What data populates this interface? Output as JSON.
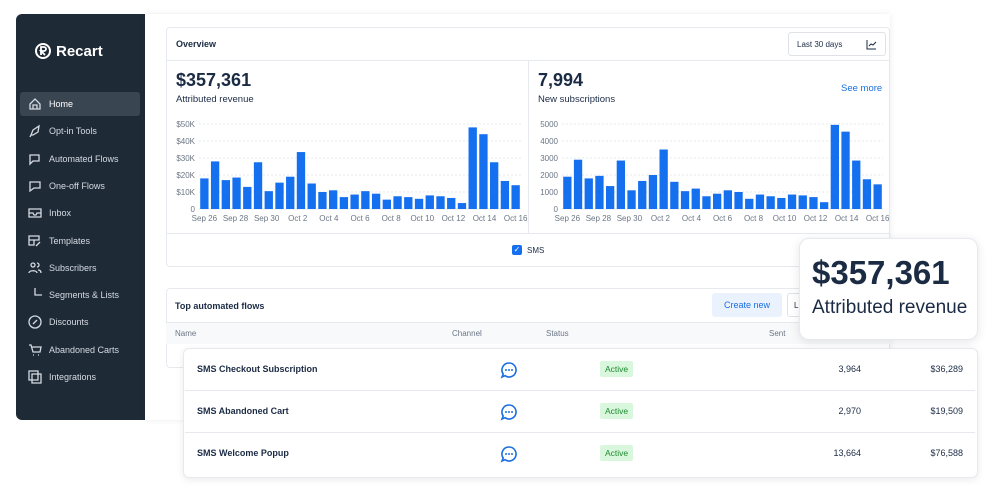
{
  "brand": {
    "name": "Recart"
  },
  "sidebar": {
    "items": [
      {
        "label": "Home",
        "icon": "home-icon",
        "active": true
      },
      {
        "label": "Opt-in Tools",
        "icon": "rocket-icon"
      },
      {
        "label": "Automated Flows",
        "icon": "chat-gear-icon"
      },
      {
        "label": "One-off Flows",
        "icon": "chat-send-icon"
      },
      {
        "label": "Inbox",
        "icon": "inbox-icon"
      },
      {
        "label": "Templates",
        "icon": "template-icon"
      },
      {
        "label": "Subscribers",
        "icon": "users-icon"
      },
      {
        "label": "Segments & Lists",
        "icon": "pie-icon"
      },
      {
        "label": "Discounts",
        "icon": "percent-icon"
      },
      {
        "label": "Abandoned Carts",
        "icon": "cart-icon"
      },
      {
        "label": "Integrations",
        "icon": "layers-icon"
      }
    ]
  },
  "overview": {
    "title": "Overview",
    "range": "Last 30 days",
    "see_more": "See more",
    "revenue": {
      "value": "$357,361",
      "label": "Attributed revenue"
    },
    "subs": {
      "value": "7,994",
      "label": "New subscriptions"
    },
    "legend": "SMS"
  },
  "accent": "#1570ef",
  "chart_data": [
    {
      "type": "bar",
      "ylim": [
        0,
        50000
      ],
      "yticks": [
        "0",
        "$10K",
        "$20K",
        "$30K",
        "$40K",
        "$50K"
      ],
      "xticks": [
        "Sep 26",
        "Sep 28",
        "Sep 30",
        "Oct 2",
        "Oct 4",
        "Oct 6",
        "Oct 8",
        "Oct 10",
        "Oct 12",
        "Oct 14",
        "Oct 16"
      ],
      "values": [
        18000,
        28000,
        17000,
        18500,
        13000,
        27500,
        10500,
        15500,
        19000,
        33500,
        15000,
        10000,
        11000,
        7000,
        8500,
        10500,
        9000,
        5500,
        7500,
        7000,
        6000,
        8000,
        7500,
        6500,
        3500,
        48000,
        44000,
        27500,
        16500,
        14000
      ]
    },
    {
      "type": "bar",
      "ylim": [
        0,
        5000
      ],
      "yticks": [
        "0",
        "1000",
        "2000",
        "3000",
        "4000",
        "5000"
      ],
      "xticks": [
        "Sep 26",
        "Sep 28",
        "Sep 30",
        "Oct 2",
        "Oct 4",
        "Oct 6",
        "Oct 8",
        "Oct 10",
        "Oct 12",
        "Oct 14",
        "Oct 16"
      ],
      "values": [
        1900,
        2900,
        1800,
        1950,
        1350,
        2850,
        1100,
        1650,
        2000,
        3500,
        1600,
        1050,
        1200,
        750,
        900,
        1100,
        1000,
        600,
        850,
        750,
        650,
        850,
        800,
        700,
        400,
        4950,
        4550,
        2850,
        1750,
        1450
      ]
    }
  ],
  "flows": {
    "title": "Top automated flows",
    "create": "Create new",
    "more": "L",
    "columns": [
      "Name",
      "Channel",
      "Status",
      "Sent"
    ],
    "rows": [
      {
        "name": "SMS Checkout Subscription",
        "status": "Active",
        "sent": "3,964",
        "revenue": "$36,289"
      },
      {
        "name": "SMS Abandoned Cart",
        "status": "Active",
        "sent": "2,970",
        "revenue": "$19,509"
      },
      {
        "name": "SMS Welcome Popup",
        "status": "Active",
        "sent": "13,664",
        "revenue": "$76,588"
      }
    ]
  },
  "callout": {
    "value": "$357,361",
    "label": "Attributed revenue"
  }
}
